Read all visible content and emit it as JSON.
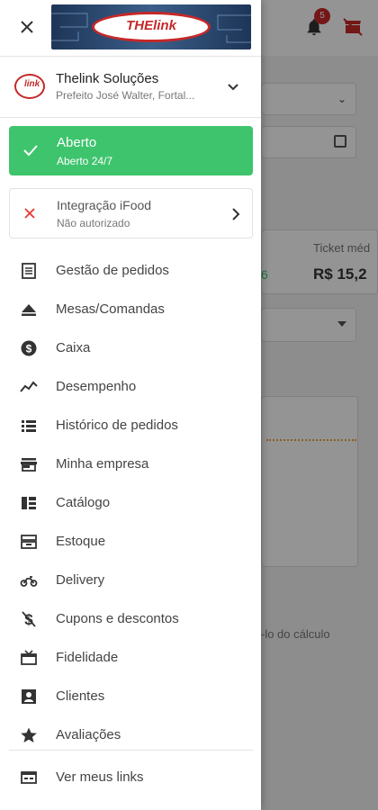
{
  "background": {
    "badge_count": "5",
    "ticket_label": "Ticket méd",
    "ticket_value": "R$ 15,2",
    "percent_fragment": "6",
    "hint_text": "-lo do cálculo"
  },
  "drawer": {
    "store": {
      "name": "Thelink Soluções",
      "address": "Prefeito José Walter, Fortal..."
    },
    "status": {
      "title": "Aberto",
      "subtitle": "Aberto 24/7",
      "color": "#3ec46d"
    },
    "ifood": {
      "title": "Integração iFood",
      "subtitle": "Não autorizado"
    },
    "menu": [
      {
        "label": "Gestão de pedidos",
        "icon": "receipt-icon"
      },
      {
        "label": "Mesas/Comandas",
        "icon": "eject-icon"
      },
      {
        "label": "Caixa",
        "icon": "dollar-circle-icon"
      },
      {
        "label": "Desempenho",
        "icon": "trending-line-icon"
      },
      {
        "label": "Histórico de pedidos",
        "icon": "list-icon"
      },
      {
        "label": "Minha empresa",
        "icon": "store-icon"
      },
      {
        "label": "Catálogo",
        "icon": "catalog-grid-icon"
      },
      {
        "label": "Estoque",
        "icon": "inventory-icon"
      },
      {
        "label": "Delivery",
        "icon": "motorbike-icon"
      },
      {
        "label": "Cupons e descontos",
        "icon": "money-off-icon"
      },
      {
        "label": "Fidelidade",
        "icon": "loyalty-icon"
      },
      {
        "label": "Clientes",
        "icon": "account-box-icon"
      },
      {
        "label": "Avaliações",
        "icon": "star-icon"
      }
    ],
    "links_label": "Ver meus links"
  },
  "colors": {
    "accent_green": "#3ec46d",
    "error_red": "#e53935",
    "badge_red": "#c62828"
  }
}
